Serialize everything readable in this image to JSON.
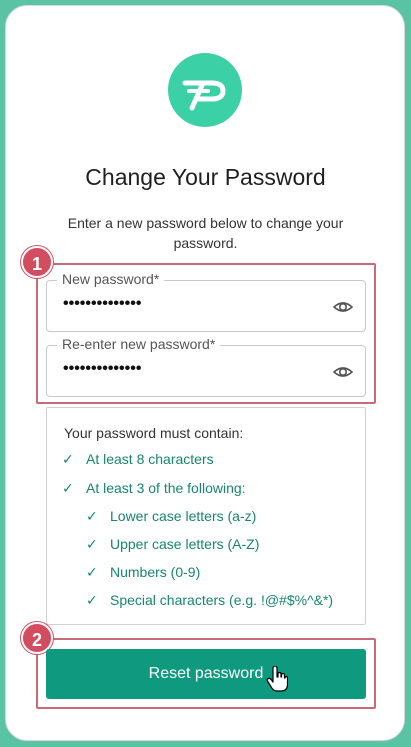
{
  "title": "Change Your Password",
  "subtitle": "Enter a new password below to change your password.",
  "fields": [
    {
      "label": "New password*",
      "value": "••••••••••••••",
      "icon": "eye-icon"
    },
    {
      "label": "Re-enter new password*",
      "value": "••••••••••••••",
      "icon": "eye-icon"
    }
  ],
  "requirements": {
    "title": "Your password must contain:",
    "items": [
      {
        "check": "✓",
        "text": "At least 8 characters"
      },
      {
        "check": "✓",
        "text": "At least 3 of the following:"
      },
      {
        "check": "✓",
        "text": "Lower case letters (a-z)"
      },
      {
        "check": "✓",
        "text": "Upper case letters (A-Z)"
      },
      {
        "check": "✓",
        "text": "Numbers (0-9)"
      },
      {
        "check": "✓",
        "text": "Special characters (e.g. !@#$%^&*)"
      }
    ]
  },
  "button": {
    "label": "Reset password"
  },
  "badges": [
    "1",
    "2"
  ],
  "colors": {
    "accent": "#0f9a7f",
    "logo": "#3cd0a7",
    "check": "#17856f",
    "badge": "#d24d5f",
    "highlight": "#c96a78",
    "background": "#5ac3a3"
  }
}
